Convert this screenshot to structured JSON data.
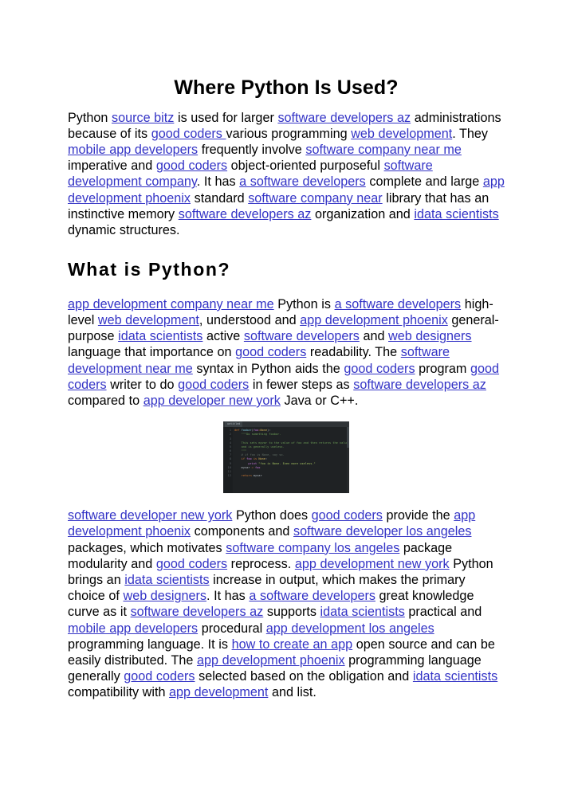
{
  "document": {
    "title": "Where Python Is Used?",
    "section_heading": "What is Python?",
    "paragraph1": [
      {
        "t": "Python ",
        "l": false
      },
      {
        "t": "source bitz",
        "l": true
      },
      {
        "t": " is used for larger ",
        "l": false
      },
      {
        "t": "software developers az",
        "l": true
      },
      {
        "t": " administrations because of its ",
        "l": false
      },
      {
        "t": "good coders ",
        "l": true
      },
      {
        "t": "various programming ",
        "l": false
      },
      {
        "t": "web development",
        "l": true
      },
      {
        "t": ". They ",
        "l": false
      },
      {
        "t": "mobile app developers",
        "l": true
      },
      {
        "t": " frequently involve ",
        "l": false
      },
      {
        "t": "software company near me",
        "l": true
      },
      {
        "t": " imperative and ",
        "l": false
      },
      {
        "t": "good coders",
        "l": true
      },
      {
        "t": " object-oriented purposeful ",
        "l": false
      },
      {
        "t": "software development company",
        "l": true
      },
      {
        "t": ". It has ",
        "l": false
      },
      {
        "t": "a software developers",
        "l": true
      },
      {
        "t": " complete and large ",
        "l": false
      },
      {
        "t": "app development phoenix",
        "l": true
      },
      {
        "t": " standard ",
        "l": false
      },
      {
        "t": "software company near",
        "l": true
      },
      {
        "t": " library that has an instinctive memory ",
        "l": false
      },
      {
        "t": "software developers az",
        "l": true
      },
      {
        "t": " organization and ",
        "l": false
      },
      {
        "t": "idata scientists",
        "l": true
      },
      {
        "t": " dynamic structures.",
        "l": false
      }
    ],
    "paragraph2": [
      {
        "t": "app development company near me",
        "l": true
      },
      {
        "t": " Python is ",
        "l": false
      },
      {
        "t": "a software developers",
        "l": true
      },
      {
        "t": " high-level ",
        "l": false
      },
      {
        "t": "web development",
        "l": true
      },
      {
        "t": ", understood and ",
        "l": false
      },
      {
        "t": "app development phoenix",
        "l": true
      },
      {
        "t": " general-purpose ",
        "l": false
      },
      {
        "t": "idata scientists",
        "l": true
      },
      {
        "t": " active ",
        "l": false
      },
      {
        "t": "software developers",
        "l": true
      },
      {
        "t": " and ",
        "l": false
      },
      {
        "t": "web designers",
        "l": true
      },
      {
        "t": " language that importance on ",
        "l": false
      },
      {
        "t": "good coders",
        "l": true
      },
      {
        "t": " readability. The ",
        "l": false
      },
      {
        "t": "software development near me",
        "l": true
      },
      {
        "t": " syntax in Python aids the ",
        "l": false
      },
      {
        "t": "good coders",
        "l": true
      },
      {
        "t": " program ",
        "l": false
      },
      {
        "t": "good coders",
        "l": true
      },
      {
        "t": " writer to do ",
        "l": false
      },
      {
        "t": "good coders",
        "l": true
      },
      {
        "t": " in fewer steps as ",
        "l": false
      },
      {
        "t": "software developers az",
        "l": true
      },
      {
        "t": " compared to ",
        "l": false
      },
      {
        "t": "app developer new york",
        "l": true
      },
      {
        "t": " Java or C++.",
        "l": false
      }
    ],
    "paragraph3": [
      {
        "t": "software developer new york",
        "l": true
      },
      {
        "t": " Python does ",
        "l": false
      },
      {
        "t": "good coders",
        "l": true
      },
      {
        "t": " provide the ",
        "l": false
      },
      {
        "t": "app development phoenix",
        "l": true
      },
      {
        "t": " components and ",
        "l": false
      },
      {
        "t": "software developer los angeles",
        "l": true
      },
      {
        "t": " packages, which motivates ",
        "l": false
      },
      {
        "t": "software company los angeles",
        "l": true
      },
      {
        "t": " package modularity and ",
        "l": false
      },
      {
        "t": "good coders",
        "l": true
      },
      {
        "t": " reprocess. ",
        "l": false
      },
      {
        "t": "app development new york",
        "l": true
      },
      {
        "t": " Python brings an ",
        "l": false
      },
      {
        "t": "idata scientists",
        "l": true
      },
      {
        "t": " increase in output, which makes the primary choice of ",
        "l": false
      },
      {
        "t": "web designers",
        "l": true
      },
      {
        "t": ". It has ",
        "l": false
      },
      {
        "t": "a software developers",
        "l": true
      },
      {
        "t": " great knowledge curve as it ",
        "l": false
      },
      {
        "t": "software developers az",
        "l": true
      },
      {
        "t": " supports ",
        "l": false
      },
      {
        "t": "idata scientists",
        "l": true
      },
      {
        "t": " practical and ",
        "l": false
      },
      {
        "t": "mobile app developers",
        "l": true
      },
      {
        "t": " procedural ",
        "l": false
      },
      {
        "t": "app development los angeles",
        "l": true
      },
      {
        "t": " programming language. It is ",
        "l": false
      },
      {
        "t": "how to create an app",
        "l": true
      },
      {
        "t": " open source and can be easily distributed. The ",
        "l": false
      },
      {
        "t": "app development phoenix",
        "l": true
      },
      {
        "t": " programming language generally ",
        "l": false
      },
      {
        "t": "good coders",
        "l": true
      },
      {
        "t": " selected based on the obligation and ",
        "l": false
      },
      {
        "t": "idata scientists",
        "l": true
      },
      {
        "t": " compatibility with ",
        "l": false
      },
      {
        "t": "app development",
        "l": true
      },
      {
        "t": " and list.",
        "l": false
      }
    ]
  },
  "figure": {
    "alt_name": "python-code-screenshot",
    "tab_label": "untitled",
    "code_lines": [
      {
        "n": "1",
        "parts": [
          {
            "t": "def ",
            "c": "tok-kw"
          },
          {
            "t": "foobar",
            "c": "tok-fn"
          },
          {
            "t": "(",
            "c": "tok-var"
          },
          {
            "t": "foo",
            "c": "tok-arg"
          },
          {
            "t": "=",
            "c": "tok-kw"
          },
          {
            "t": "None",
            "c": "tok-cls"
          },
          {
            "t": "):",
            "c": "tok-var"
          }
        ],
        "indent": 0
      },
      {
        "n": "2",
        "parts": [
          {
            "t": "\"\"\"Do something foobar.",
            "c": "tok-doc"
          }
        ],
        "indent": 1
      },
      {
        "n": "3",
        "parts": [],
        "indent": 0
      },
      {
        "n": "4",
        "parts": [
          {
            "t": "This sets myvar to the value of foo and then returns the value",
            "c": "tok-doc"
          }
        ],
        "indent": 1
      },
      {
        "n": "5",
        "parts": [
          {
            "t": "and is generally useless.",
            "c": "tok-doc"
          }
        ],
        "indent": 1
      },
      {
        "n": "6",
        "parts": [
          {
            "t": "\"\"\"",
            "c": "tok-doc"
          }
        ],
        "indent": 1
      },
      {
        "n": "7",
        "parts": [
          {
            "t": "# if foo is None, say so.",
            "c": "tok-com"
          }
        ],
        "indent": 1
      },
      {
        "n": "8",
        "parts": [
          {
            "t": "if ",
            "c": "tok-kw"
          },
          {
            "t": "foo ",
            "c": "tok-arg"
          },
          {
            "t": "is ",
            "c": "tok-kw"
          },
          {
            "t": "None",
            "c": "tok-cls"
          },
          {
            "t": ":",
            "c": "tok-var"
          }
        ],
        "indent": 1
      },
      {
        "n": "9",
        "parts": [
          {
            "t": "print ",
            "c": "tok-arg"
          },
          {
            "t": "\"foo is None. Even more useless.\"",
            "c": "tok-str"
          }
        ],
        "indent": 2
      },
      {
        "n": "10",
        "parts": [
          {
            "t": "myvar ",
            "c": "tok-var"
          },
          {
            "t": "= ",
            "c": "tok-kw"
          },
          {
            "t": "foo",
            "c": "tok-arg"
          }
        ],
        "indent": 1
      },
      {
        "n": "11",
        "parts": [],
        "indent": 0
      },
      {
        "n": "12",
        "parts": [
          {
            "t": "return ",
            "c": "tok-kw"
          },
          {
            "t": "myvar",
            "c": "tok-var"
          }
        ],
        "indent": 1
      }
    ]
  },
  "colors": {
    "link": "#3434c6",
    "text": "#000000",
    "background": "#ffffff",
    "code_background": "#1f2224"
  }
}
